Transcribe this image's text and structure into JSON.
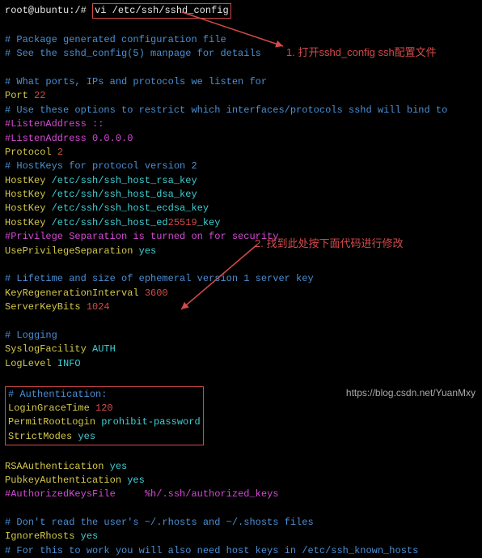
{
  "prompt": "root@ubuntu:/# ",
  "command": "vi /etc/ssh/sshd_config",
  "lines": {
    "l1": "# Package generated configuration file",
    "l2": "# See the sshd_config(5) manpage for details",
    "l3": "# What ports, IPs and protocols we listen for",
    "port_k": "Port ",
    "port_v": "22",
    "l5": "# Use these options to restrict which interfaces/protocols sshd will bind to",
    "l6": "#ListenAddress ::",
    "l7": "#ListenAddress 0.0.0.0",
    "proto_k": "Protocol ",
    "proto_v": "2",
    "l9": "# HostKeys for protocol version 2",
    "hk1_k": "HostKey ",
    "hk1_v": "/etc/ssh/ssh_host_rsa_key",
    "hk2_k": "HostKey ",
    "hk2_v": "/etc/ssh/ssh_host_dsa_key",
    "hk3_k": "HostKey ",
    "hk3_v": "/etc/ssh/ssh_host_ecdsa_key",
    "hk4_k": "HostKey ",
    "hk4_v1": "/etc/ssh/ssh_host_ed",
    "hk4_v2": "25519",
    "hk4_v3": "_key",
    "l14": "#Privilege Separation is turned on for security",
    "ups_k": "UsePrivilegeSeparation ",
    "ups_v": "yes",
    "l16": "# Lifetime and size of ephemeral version 1 server key",
    "kri_k": "KeyRegenerationInterval ",
    "kri_v": "3600",
    "skb_k": "ServerKeyBits ",
    "skb_v": "1024",
    "l19": "# Logging",
    "sf_k": "SyslogFacility ",
    "sf_v": "AUTH",
    "ll_k": "LogLevel ",
    "ll_v": "INFO",
    "auth_hdr": "# Authentication:",
    "lgt_k": "LoginGraceTime ",
    "lgt_v": "120",
    "prl_k": "PermitRootLogin ",
    "prl_v": "prohibit-password",
    "sm_k": "StrictModes ",
    "sm_v": "yes",
    "rsa_k": "RSAAuthentication ",
    "rsa_v": "yes",
    "pk_k": "PubkeyAuthentication ",
    "pk_v": "yes",
    "akf_k": "#AuthorizedKeysFile",
    "akf_v": "%h/.ssh/authorized_keys",
    "l30": "# Don't read the user's ~/.rhosts and ~/.shosts files",
    "ir_k": "IgnoreRhosts ",
    "ir_v": "yes",
    "l32a": "# For this to work you will also need host keys in /etc/ssh_known_ho",
    "l32b": "sts"
  },
  "annotations": {
    "a1": "1. 打开sshd_config ssh配置文件",
    "a2": "2. 找到此处按下面代码进行修改"
  },
  "watermark": "https://blog.csdn.net/YuanMxy"
}
